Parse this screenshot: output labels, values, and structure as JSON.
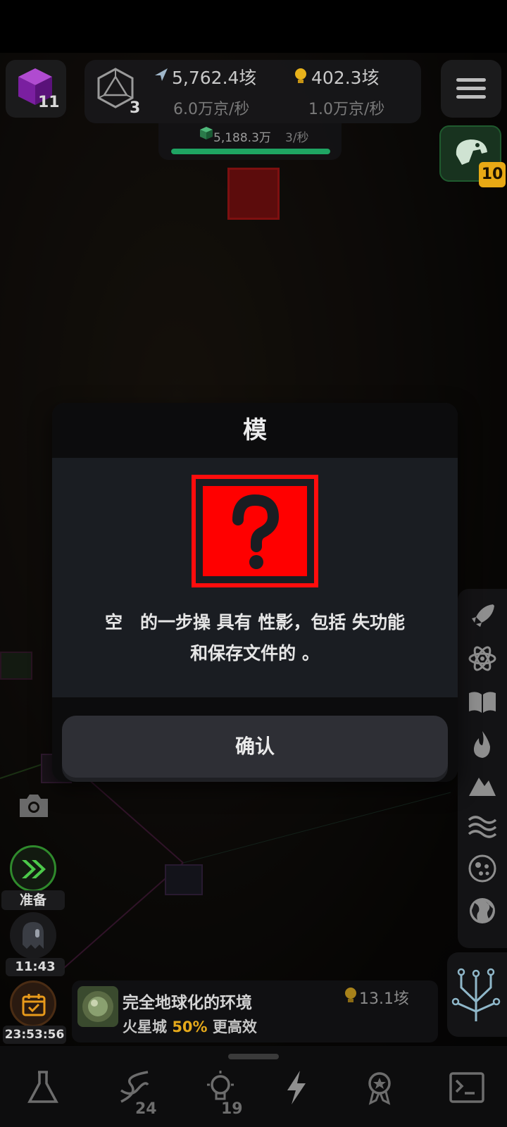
{
  "hud": {
    "cube_count": "11",
    "d20_count": "3",
    "energy_total": "5,762.4垓",
    "energy_rate": "6.0万京/秒",
    "idea_total": "402.3垓",
    "idea_rate": "1.0万京/秒",
    "sub_total": "5,188.3万",
    "sub_rate": "3/秒",
    "sub_progress": 1.0
  },
  "dino": {
    "badge": "10"
  },
  "left_controls": {
    "ready_label": "准备",
    "timer_1": "11:43",
    "timer_2": "23:53:56"
  },
  "mission": {
    "title": "完全地球化的环境",
    "subtitle_city": "火星城",
    "subtitle_pct": "50%",
    "subtitle_rest": "更高效",
    "cost": "13.1垓"
  },
  "bottom_nav": {
    "dna_count": "24",
    "idea_count": "19"
  },
  "modal": {
    "title": "模",
    "body_line1": "空　的一步操 具有 性影，包括 失功能",
    "body_line2": "和保存文件的 。",
    "confirm_label": "确认"
  },
  "colors": {
    "accent_red": "#ff0000",
    "progress_green": "#1fa463",
    "badge_gold": "#e8a915"
  }
}
